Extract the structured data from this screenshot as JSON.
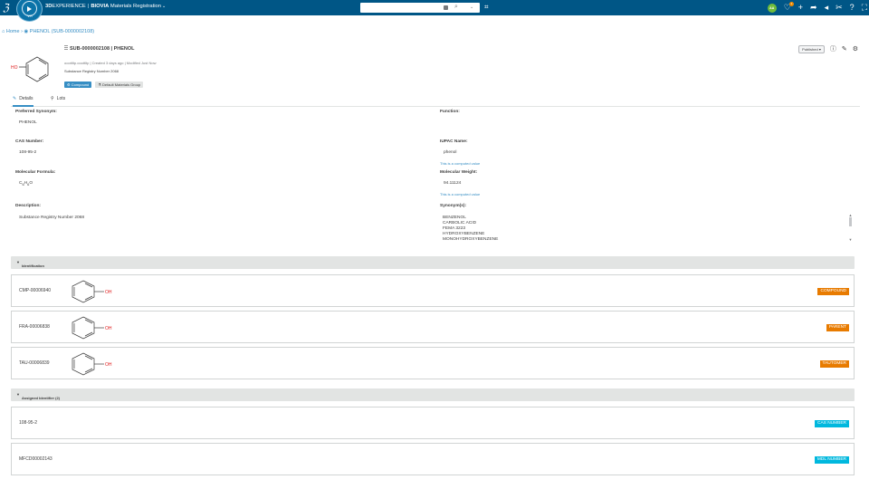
{
  "topbar": {
    "brand_3d": "3D",
    "brand_experience": "EXPERIENCE",
    "brand_sep": "|",
    "brand_company": "BIOVIA",
    "brand_app": "Materials Registration",
    "compass_label": "V.R",
    "avatar_initials": "AA",
    "notification_count": "1"
  },
  "breadcrumb": {
    "home": "Home",
    "sep": "›",
    "current": "PHENOL (SUB-0000002108)"
  },
  "header": {
    "title": "SUB-0000002108 | PHENOL",
    "meta": "ooottltp.ooottltp | Created 3 days ago | Modified Just Now",
    "registry": "Substance Registry Number 2068",
    "chip_compound": "Compound",
    "chip_group": "Default Materials Group",
    "status": "Published ▾"
  },
  "tabs": [
    {
      "label": "Details"
    },
    {
      "label": "Lots"
    }
  ],
  "fields": {
    "preferred_synonym": {
      "label": "Preferred Synonym:",
      "value": "PHENOL"
    },
    "function": {
      "label": "Function:",
      "value": ""
    },
    "cas_number": {
      "label": "CAS Number:",
      "value": "108-95-2"
    },
    "iupac_name": {
      "label": "IUPAC Name:",
      "value": "phenol",
      "note": "This is a computed value"
    },
    "molecular_formula": {
      "label": "Molecular Formula:",
      "value_c": "C",
      "value_c_sub": "6",
      "value_h": "H",
      "value_h_sub": "6",
      "value_o": "O"
    },
    "molecular_weight": {
      "label": "Molecular Weight:",
      "value": "94.11124",
      "note": "This is a computed value"
    },
    "description": {
      "label": "Description:",
      "value": "Substance Registry Number 2068"
    },
    "synonyms": {
      "label": "Synonym(s):",
      "items": [
        "BENZENOL",
        "CARBOLIC ACID",
        "FEMA 3223",
        "HYDROXYBENZENE",
        "MONOHYDROXYBENZENE"
      ]
    }
  },
  "identification": {
    "header": "Identification",
    "cards": [
      {
        "id": "CMP-00006940",
        "badge": "COMPOUND",
        "atom": "OH"
      },
      {
        "id": "FRA-00006838",
        "badge": "PARENT",
        "atom": "OH"
      },
      {
        "id": "TAU-00006839",
        "badge": "TAUTOMER",
        "atom": "OH"
      }
    ]
  },
  "assigned": {
    "header": "Assigned Identifier (2)",
    "cards": [
      {
        "id": "108-95-2",
        "badge": "CAS NUMBER"
      },
      {
        "id": "MFCD00002143",
        "badge": "MDL NUMBER"
      }
    ]
  },
  "structure": {
    "atom": "HO"
  },
  "colors": {
    "topbar": "#005686",
    "accent": "#368ec4",
    "badge_orange": "#e87b00",
    "badge_cyan": "#00b8de",
    "heteroatom": "#e02020"
  }
}
